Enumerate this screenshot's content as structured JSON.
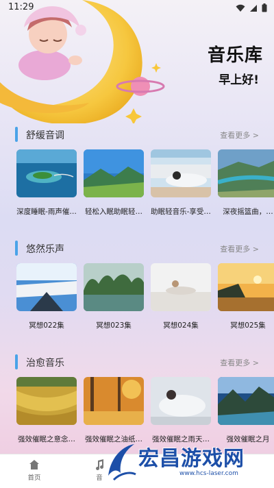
{
  "status": {
    "time": "11:29"
  },
  "header": {
    "title": "音乐库",
    "greeting": "早上好!"
  },
  "sections": [
    {
      "title": "舒缓音调",
      "more": "查看更多 >",
      "items": [
        {
          "caption": "深度睡眠-雨声催…"
        },
        {
          "caption": "轻松入眠助眠轻…"
        },
        {
          "caption": "助眠轻音乐-享受…"
        },
        {
          "caption": "深夜摇篮曲，…"
        }
      ]
    },
    {
      "title": "悠然乐声",
      "more": "查看更多 >",
      "items": [
        {
          "caption": "冥想022集"
        },
        {
          "caption": "冥想023集"
        },
        {
          "caption": "冥想024集"
        },
        {
          "caption": "冥想025集"
        }
      ]
    },
    {
      "title": "治愈音乐",
      "more": "查看更多 >",
      "items": [
        {
          "caption": "强效催眠之意念…"
        },
        {
          "caption": "强效催眠之油纸…"
        },
        {
          "caption": "强效催眠之雨天…"
        },
        {
          "caption": "强效催眠之月"
        }
      ]
    }
  ],
  "bottom_nav": {
    "home_label": "首页",
    "second_label": "音"
  },
  "watermark": {
    "text": "宏昌游戏网",
    "url": "www.hcs-laser.com"
  },
  "colors": {
    "accent": "#4aa3e8",
    "moon": "#f6c73f"
  }
}
